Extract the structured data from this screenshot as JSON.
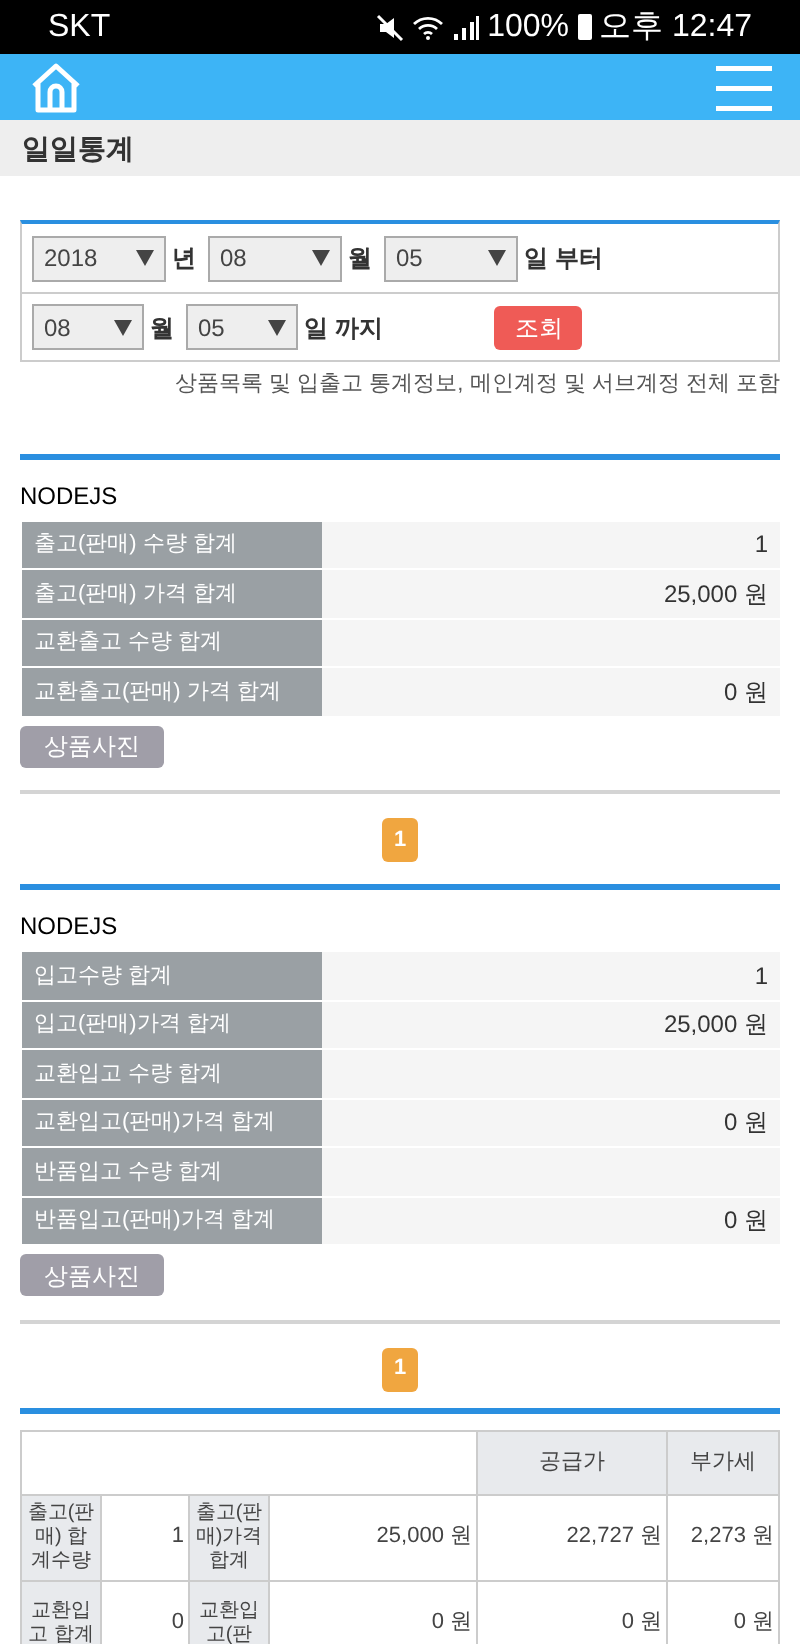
{
  "status_bar": {
    "carrier": "SKT",
    "battery": "100%",
    "time": "오후 12:47"
  },
  "page_title": "일일통계",
  "filter": {
    "rows": [
      {
        "fields": [
          {
            "value": "2018",
            "unit": "년",
            "wide": true
          },
          {
            "value": "08",
            "unit": "월",
            "wide": true
          },
          {
            "value": "05",
            "unit": "일 부터",
            "wide": true
          }
        ]
      },
      {
        "fields": [
          {
            "value": "08",
            "unit": "월",
            "wide": false
          },
          {
            "value": "05",
            "unit": "일 까지",
            "wide": false
          }
        ],
        "button": "조회"
      }
    ]
  },
  "note": "상품목록 및 입출고 통계정보, 메인계정 및 서브계정 전체 포함",
  "sections": [
    {
      "title": "NODEJS",
      "rows": [
        {
          "label": "출고(판매) 수량 합계",
          "value": "1"
        },
        {
          "label": "출고(판매) 가격 합계",
          "value": "25,000 원"
        },
        {
          "label": "교환출고 수량 합계"
        },
        {
          "label": "교환출고(판매) 가격 합계",
          "value": "0 원"
        }
      ],
      "photo_button": "상품사진",
      "pages": [
        {
          "label": "1",
          "selected": true
        }
      ]
    },
    {
      "title": "NODEJS",
      "rows": [
        {
          "label": "입고수량 합계",
          "value": "1"
        },
        {
          "label": "입고(판매)가격 합계",
          "value": "25,000 원"
        },
        {
          "label": "교환입고 수량 합계"
        },
        {
          "label": "교환입고(판매)가격 합계",
          "value": "0 원"
        },
        {
          "label": "반품입고 수량 합계"
        },
        {
          "label": "반품입고(판매)가격 합계",
          "value": "0 원"
        }
      ],
      "photo_button": "상품사진",
      "pages": [
        {
          "label": "1",
          "selected": true
        }
      ]
    }
  ],
  "summary": {
    "columns": [
      "",
      "",
      "",
      "",
      "공급가",
      "부가세"
    ],
    "rows": [
      {
        "cells": [
          "출고(판매) 합계수량",
          "1",
          "출고(판매)가격 합계",
          "25,000 원",
          "22,727 원",
          "2,273 원"
        ]
      },
      {
        "cells": [
          "교환입고 합계",
          "0",
          "교환입고(판",
          "0 원",
          "0 원",
          "0 원"
        ]
      }
    ]
  }
}
